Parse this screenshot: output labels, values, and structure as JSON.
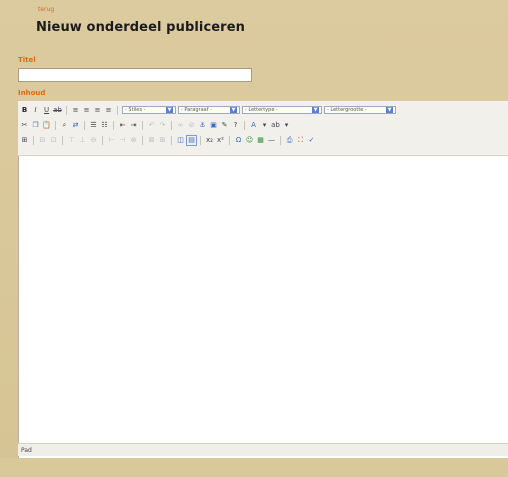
{
  "nav": {
    "back_label": "terug"
  },
  "header": {
    "title": "Nieuw onderdeel publiceren"
  },
  "form": {
    "title_label": "Titel",
    "title_value": "",
    "content_label": "Inhoud"
  },
  "toolbar": {
    "styles_select": "- Stiles -",
    "format_select": "- Paragraaf -",
    "font_select": "- Lettertype -",
    "fontsize_select": "- Lettergrootte -"
  },
  "editor": {
    "status_path": "Pad"
  }
}
